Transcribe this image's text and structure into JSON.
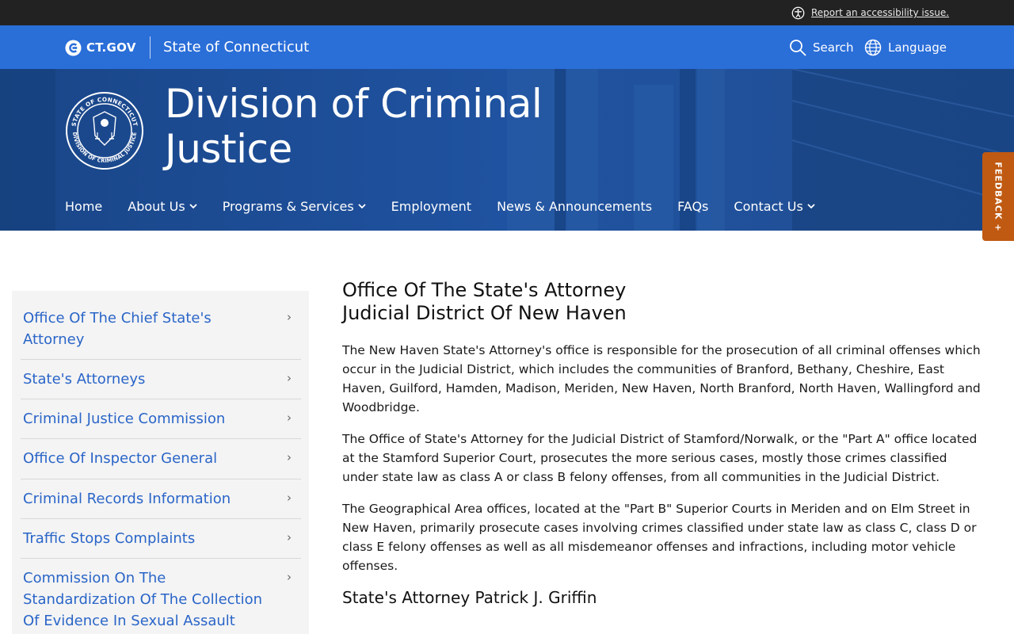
{
  "accessibility": {
    "link_text": "Report an accessibility issue."
  },
  "ctgov": {
    "logo_text": "CT.GOV",
    "state_name": "State of Connecticut",
    "search_label": "Search",
    "language_label": "Language"
  },
  "hero": {
    "title": "Division of Criminal Justice",
    "seal_top_text": "STATE OF CONNECTICUT",
    "seal_bottom_text": "DIVISION OF CRIMINAL JUSTICE"
  },
  "nav": [
    {
      "label": "Home",
      "has_dropdown": false
    },
    {
      "label": "About Us",
      "has_dropdown": true
    },
    {
      "label": "Programs & Services",
      "has_dropdown": true
    },
    {
      "label": "Employment",
      "has_dropdown": false
    },
    {
      "label": "News & Announcements",
      "has_dropdown": false
    },
    {
      "label": "FAQs",
      "has_dropdown": false
    },
    {
      "label": "Contact Us",
      "has_dropdown": true
    }
  ],
  "feedback": {
    "label": "FEEDBACK +"
  },
  "sidebar": {
    "items": [
      {
        "label": "Office Of The Chief State's Attorney"
      },
      {
        "label": "State's Attorneys"
      },
      {
        "label": "Criminal Justice Commission"
      },
      {
        "label": "Office Of Inspector General"
      },
      {
        "label": "Criminal Records Information"
      },
      {
        "label": "Traffic Stops Complaints"
      },
      {
        "label": "Commission On The Standardization Of The Collection Of Evidence In Sexual Assault"
      }
    ],
    "arrow_glyph": "›"
  },
  "main": {
    "title_line1": "Office Of The State's Attorney",
    "title_line2": "Judicial District Of New Haven",
    "paragraphs": [
      "The New Haven State's Attorney's office is responsible for the prosecution of all criminal offenses which occur in the Judicial District, which includes the communities of Branford, Bethany, Cheshire, East Haven, Guilford, Hamden, Madison, Meriden, New Haven, North Branford, North Haven, Wallingford and Woodbridge.",
      "The Office of State's Attorney for the Judicial District of Stamford/Norwalk, or the \"Part A\" office located at the Stamford Superior Court, prosecutes the more serious cases, mostly those crimes classified under state law as class A or class B felony offenses, from all communities in the Judicial District.",
      "The Geographical Area offices, located at the \"Part B\" Superior Courts in Meriden and on Elm Street in New Haven, primarily prosecute cases involving crimes classified under state law as class C, class D or class E felony offenses as well as all misdemeanor offenses and infractions, including motor vehicle offenses."
    ],
    "subheading": "State's Attorney Patrick J. Griffin"
  },
  "colors": {
    "topbar": "#222222",
    "ctbar": "#2a6ed8",
    "hero": "#1d4e94",
    "link": "#2a65c8",
    "feedback": "#c05a12",
    "sidebar_bg": "#f4f4f4"
  },
  "icons": {
    "accessibility": "accessibility-icon",
    "ct_logo": "ct-logo-icon",
    "search": "search-icon",
    "language": "globe-icon",
    "dropdown": "chevron-down-icon",
    "sidebar_arrow": "chevron-right-icon",
    "seal": "state-seal-icon"
  }
}
